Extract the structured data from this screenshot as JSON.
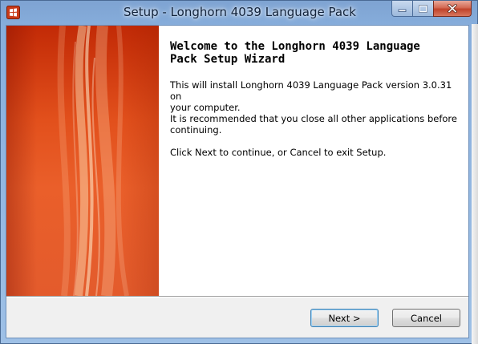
{
  "window": {
    "title": "Setup - Longhorn 4039 Language Pack",
    "icons": {
      "app": "setup-app-icon",
      "minimize": "minimize-icon",
      "maximize": "maximize-icon",
      "close": "close-icon"
    },
    "colors": {
      "banner": "#e2501c",
      "close_button": "#c0432b",
      "content_bg": "#ffffff"
    }
  },
  "wizard": {
    "heading_line1": "Welcome to the Longhorn 4039 Language",
    "heading_line2": "Pack Setup Wizard",
    "paragraph1_line1": "This will install Longhorn 4039 Language Pack version 3.0.31 on",
    "paragraph1_line2": "your computer.",
    "paragraph2_line1": "It is recommended that you close all other applications before",
    "paragraph2_line2": "continuing.",
    "paragraph3": "Click Next to continue, or Cancel to exit Setup."
  },
  "buttons": {
    "next": "Next >",
    "cancel": "Cancel"
  }
}
